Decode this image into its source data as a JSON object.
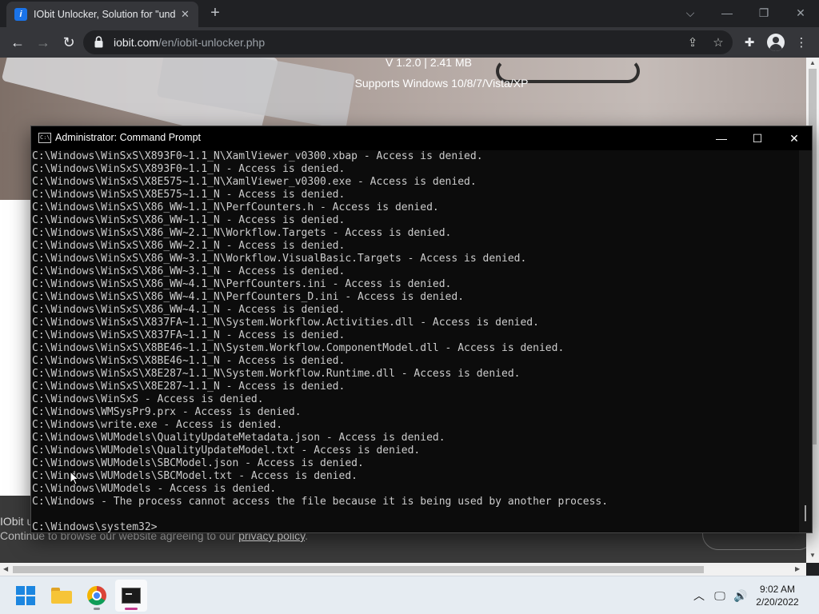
{
  "browser": {
    "tab": {
      "title": "IObit Unlocker, Solution for \"und",
      "favicon_letter": "i"
    },
    "url": {
      "host": "iobit.com",
      "path": "/en/iobit-unlocker.php"
    }
  },
  "page": {
    "version": "V 1.2.0 | 2.41 MB",
    "supports": "Supports Windows 10/8/7/Vista/XP",
    "cookie_text_line1": "IObit u",
    "cookie_text_line2": "Continue to browse our website agreeing to our ",
    "privacy_link": "privacy policy",
    "cookie_text_end": "."
  },
  "cmd": {
    "title": "Administrator: Command Prompt",
    "lines": [
      "C:\\Windows\\WinSxS\\X893F0~1.1_N\\XamlViewer_v0300.xbap - Access is denied.",
      "C:\\Windows\\WinSxS\\X893F0~1.1_N - Access is denied.",
      "C:\\Windows\\WinSxS\\X8E575~1.1_N\\XamlViewer_v0300.exe - Access is denied.",
      "C:\\Windows\\WinSxS\\X8E575~1.1_N - Access is denied.",
      "C:\\Windows\\WinSxS\\X86_WW~1.1_N\\PerfCounters.h - Access is denied.",
      "C:\\Windows\\WinSxS\\X86_WW~1.1_N - Access is denied.",
      "C:\\Windows\\WinSxS\\X86_WW~2.1_N\\Workflow.Targets - Access is denied.",
      "C:\\Windows\\WinSxS\\X86_WW~2.1_N - Access is denied.",
      "C:\\Windows\\WinSxS\\X86_WW~3.1_N\\Workflow.VisualBasic.Targets - Access is denied.",
      "C:\\Windows\\WinSxS\\X86_WW~3.1_N - Access is denied.",
      "C:\\Windows\\WinSxS\\X86_WW~4.1_N\\PerfCounters.ini - Access is denied.",
      "C:\\Windows\\WinSxS\\X86_WW~4.1_N\\PerfCounters_D.ini - Access is denied.",
      "C:\\Windows\\WinSxS\\X86_WW~4.1_N - Access is denied.",
      "C:\\Windows\\WinSxS\\X837FA~1.1_N\\System.Workflow.Activities.dll - Access is denied.",
      "C:\\Windows\\WinSxS\\X837FA~1.1_N - Access is denied.",
      "C:\\Windows\\WinSxS\\X8BE46~1.1_N\\System.Workflow.ComponentModel.dll - Access is denied.",
      "C:\\Windows\\WinSxS\\X8BE46~1.1_N - Access is denied.",
      "C:\\Windows\\WinSxS\\X8E287~1.1_N\\System.Workflow.Runtime.dll - Access is denied.",
      "C:\\Windows\\WinSxS\\X8E287~1.1_N - Access is denied.",
      "C:\\Windows\\WinSxS - Access is denied.",
      "C:\\Windows\\WMSysPr9.prx - Access is denied.",
      "C:\\Windows\\write.exe - Access is denied.",
      "C:\\Windows\\WUModels\\QualityUpdateMetadata.json - Access is denied.",
      "C:\\Windows\\WUModels\\QualityUpdateModel.txt - Access is denied.",
      "C:\\Windows\\WUModels\\SBCModel.json - Access is denied.",
      "C:\\Windows\\WUModels\\SBCModel.txt - Access is denied.",
      "C:\\Windows\\WUModels - Access is denied.",
      "C:\\Windows - The process cannot access the file because it is being used by another process.",
      "",
      "C:\\Windows\\system32>"
    ]
  },
  "taskbar": {
    "time": "9:02 AM",
    "date": "2/20/2022"
  }
}
